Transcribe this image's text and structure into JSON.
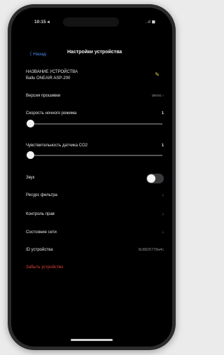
{
  "status_bar": {
    "time": "10:15 ◂",
    "right": "..ıl ◼"
  },
  "nav": {
    "back_label": "〈 Назад",
    "title": "Настройки устройства"
  },
  "device": {
    "name_label": "НАЗВАНИЕ УСТРОЙСТВА",
    "name_value": "Ballu ONEAIR ASP-200",
    "edit_icon": "pencil-icon"
  },
  "settings": {
    "firmware_label": "Версия прошивки",
    "firmware_value": "demo",
    "night_speed_label": "Скорость ночного режима",
    "night_speed_value": "1",
    "night_speed_level": 0,
    "co2_label": "Чувствительность датчика CO2",
    "co2_value": "1",
    "co2_level": 0,
    "sound_label": "Звук",
    "sound_on": false,
    "filter_label": "Ресурс фильтра",
    "rights_label": "Контроль прав",
    "network_label": "Состояние сети",
    "device_id_label": "ID устройства",
    "device_id_value": "8c8825778a4c",
    "forget_label": "Забыть устройство"
  },
  "colors": {
    "accent": "#4a8ef0",
    "danger": "#e0413a",
    "edit": "#d4d23a"
  }
}
